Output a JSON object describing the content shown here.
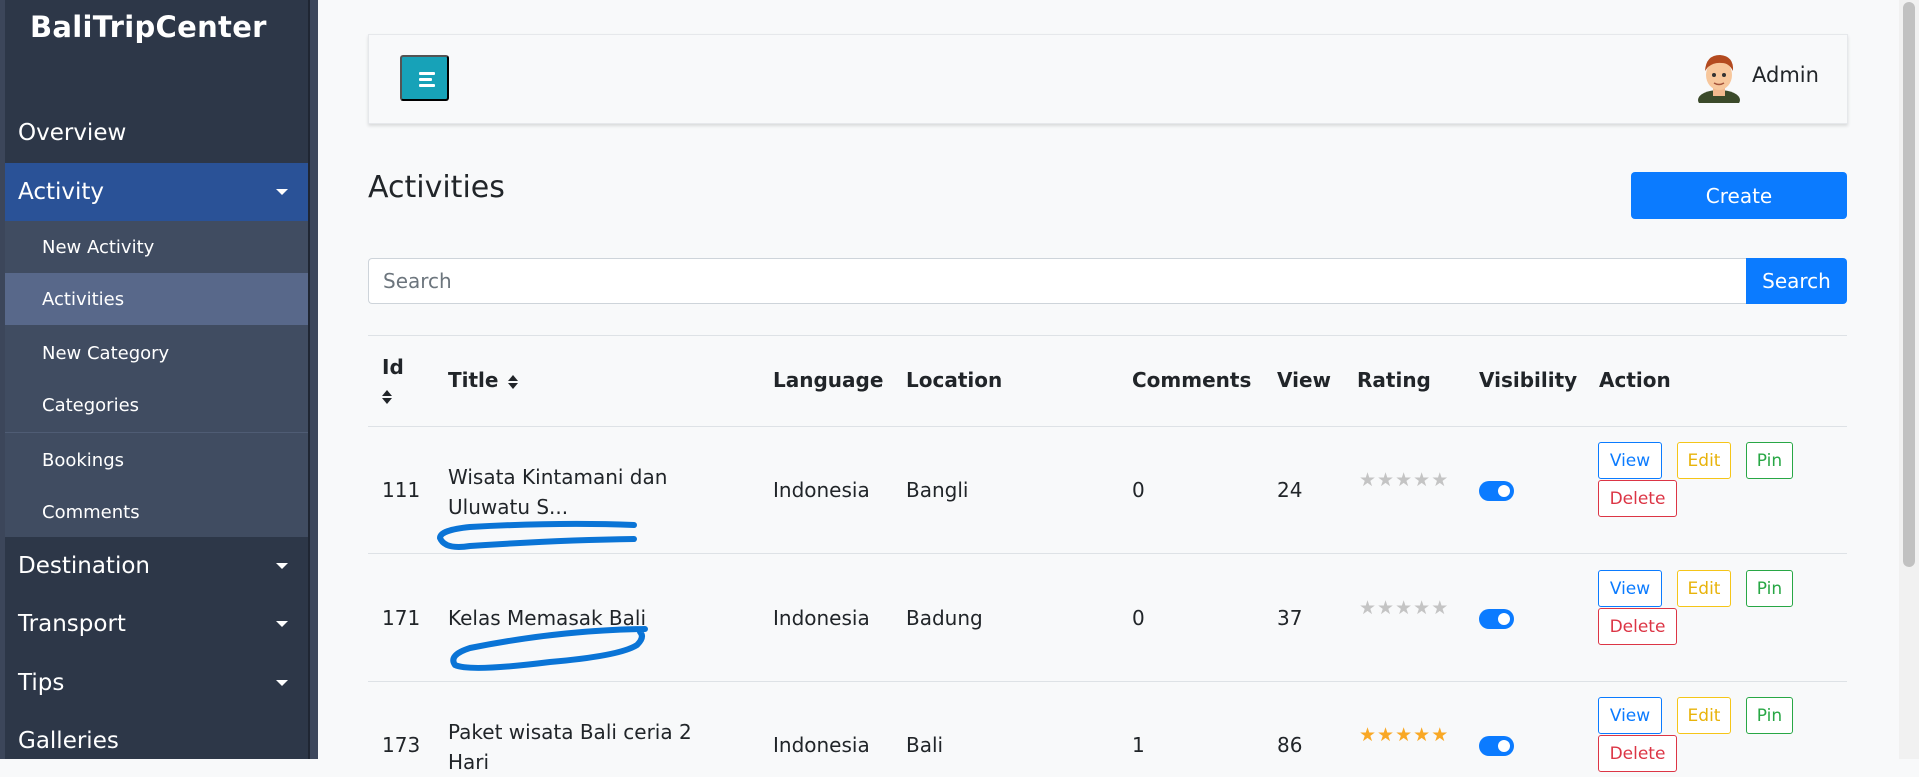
{
  "sidebar": {
    "brand": "BaliTripCenter",
    "items": [
      {
        "label": "Overview"
      },
      {
        "label": "Activity"
      },
      {
        "label": "Destination"
      },
      {
        "label": "Transport"
      },
      {
        "label": "Tips"
      },
      {
        "label": "Galleries"
      }
    ],
    "submenu": [
      {
        "label": "New Activity"
      },
      {
        "label": "Activities"
      },
      {
        "label": "New Category"
      },
      {
        "label": "Categories"
      },
      {
        "label": "Bookings"
      },
      {
        "label": "Comments"
      }
    ]
  },
  "topbar": {
    "user_name": "Admin"
  },
  "page": {
    "title": "Activities",
    "create_label": "Create"
  },
  "search": {
    "placeholder": "Search",
    "value": "",
    "button_label": "Search"
  },
  "table": {
    "headers": {
      "id": "Id",
      "title": "Title",
      "language": "Language",
      "location": "Location",
      "comments": "Comments",
      "view": "View",
      "rating": "Rating",
      "visibility": "Visibility",
      "action": "Action"
    },
    "rows": [
      {
        "id": "111",
        "title": "Wisata Kintamani dan Uluwatu S...",
        "language": "Indonesia",
        "location": "Bangli",
        "comments": "0",
        "view": "24",
        "rating": 0,
        "visible": true
      },
      {
        "id": "171",
        "title": "Kelas Memasak Bali",
        "language": "Indonesia",
        "location": "Badung",
        "comments": "0",
        "view": "37",
        "rating": 0,
        "visible": true
      },
      {
        "id": "173",
        "title": "Paket wisata Bali ceria 2 Hari",
        "language": "Indonesia",
        "location": "Bali",
        "comments": "1",
        "view": "86",
        "rating": 5,
        "visible": true
      }
    ],
    "action_labels": {
      "view": "View",
      "edit": "Edit",
      "pin": "Pin",
      "delete": "Delete"
    }
  },
  "colors": {
    "sidebar_bg": "#2d3748",
    "sidebar_active": "#2a5297",
    "submenu_bg": "#404c61",
    "primary": "#0b7bff",
    "info": "#17a2b8",
    "star_filled": "#f9a825",
    "star_empty": "#c4c4c4",
    "annotation_stroke": "#0a74d6"
  }
}
